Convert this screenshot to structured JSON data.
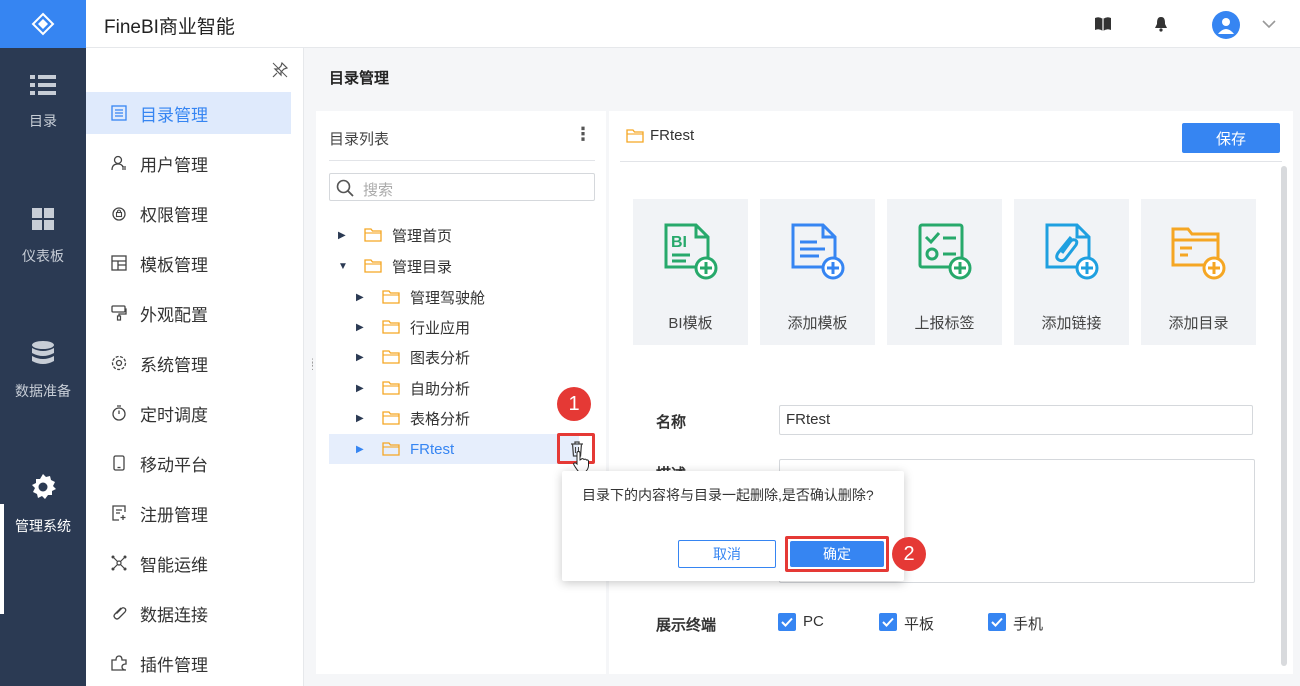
{
  "app": {
    "title": "FineBI商业智能"
  },
  "rail": {
    "items": [
      {
        "label": "目录",
        "icon": "list-icon"
      },
      {
        "label": "仪表板",
        "icon": "dashboard-icon"
      },
      {
        "label": "数据准备",
        "icon": "database-icon"
      },
      {
        "label": "管理系统",
        "icon": "gear-icon"
      }
    ],
    "active": "管理系统"
  },
  "sidebar": {
    "items": [
      {
        "label": "目录管理",
        "icon": "list-icon"
      },
      {
        "label": "用户管理",
        "icon": "user-icon"
      },
      {
        "label": "权限管理",
        "icon": "lock-icon"
      },
      {
        "label": "模板管理",
        "icon": "template-icon"
      },
      {
        "label": "外观配置",
        "icon": "brush-icon"
      },
      {
        "label": "系统管理",
        "icon": "gear-icon"
      },
      {
        "label": "定时调度",
        "icon": "timer-icon"
      },
      {
        "label": "移动平台",
        "icon": "mobile-icon"
      },
      {
        "label": "注册管理",
        "icon": "register-icon"
      },
      {
        "label": "智能运维",
        "icon": "network-icon"
      },
      {
        "label": "数据连接",
        "icon": "link-icon"
      },
      {
        "label": "插件管理",
        "icon": "plugin-icon"
      }
    ],
    "active": "目录管理"
  },
  "page": {
    "title": "目录管理"
  },
  "tree": {
    "header": "目录列表",
    "search_placeholder": "搜索",
    "nodes": [
      {
        "label": "管理首页",
        "expanded": false,
        "level": 0
      },
      {
        "label": "管理目录",
        "expanded": true,
        "level": 0
      },
      {
        "label": "管理驾驶舱",
        "expanded": false,
        "level": 1
      },
      {
        "label": "行业应用",
        "expanded": false,
        "level": 1
      },
      {
        "label": "图表分析",
        "expanded": false,
        "level": 1
      },
      {
        "label": "自助分析",
        "expanded": false,
        "level": 1
      },
      {
        "label": "表格分析",
        "expanded": false,
        "level": 1
      },
      {
        "label": "FRtest",
        "expanded": false,
        "level": 1,
        "selected": true
      }
    ]
  },
  "detail": {
    "folder_name": "FRtest",
    "save_label": "保存",
    "cards": [
      {
        "label": "BI模板",
        "icon": "bi-template-icon",
        "color": "#27a96b"
      },
      {
        "label": "添加模板",
        "icon": "add-template-icon",
        "color": "#3685f2"
      },
      {
        "label": "上报标签",
        "icon": "report-tag-icon",
        "color": "#27a96b"
      },
      {
        "label": "添加链接",
        "icon": "add-link-icon",
        "color": "#1fa0e0"
      },
      {
        "label": "添加目录",
        "icon": "add-folder-icon",
        "color": "#f5a623"
      }
    ],
    "name_label": "名称",
    "name_value": "FRtest",
    "desc_label": "描述",
    "terminal_label": "展示终端",
    "terminals": [
      {
        "label": "PC",
        "checked": true
      },
      {
        "label": "平板",
        "checked": true
      },
      {
        "label": "手机",
        "checked": true
      }
    ]
  },
  "dialog": {
    "message": "目录下的内容将与目录一起删除,是否确认删除?",
    "cancel_label": "取消",
    "confirm_label": "确定"
  },
  "annotations": {
    "step1": "1",
    "step2": "2"
  },
  "colors": {
    "accent": "#3685f2",
    "rail": "#2b3a53",
    "highlight": "#e53935",
    "folder": "#f5a623"
  }
}
